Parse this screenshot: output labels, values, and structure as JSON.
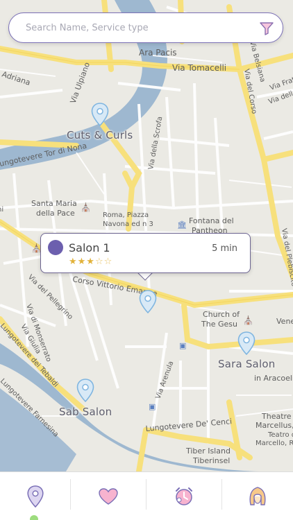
{
  "search": {
    "placeholder": "Search Name, Service type",
    "filter_icon": "filter-icon"
  },
  "map": {
    "street_labels": [
      "Via Tomacelli",
      "Via del Corso",
      "Ara Pacis",
      "Adriana",
      "Via Ulpiano",
      "Lungotevere Tor di Nona",
      "Via della Scrofa",
      "Santa Maria della Pace",
      "Roma, Piazza Navona ed n 3",
      "Fontana del Pantheon",
      "Corso Vittorio Emanuele",
      "Via del Pellegrino",
      "Via di Monserrato",
      "Via Giulia",
      "Church of The Gesu",
      "Lungotevere dei Tebaldi",
      "Lungotevere Farnesina",
      "Via Arenula",
      "Lungotevere De' Cenci",
      "Tiber Island Tiberinsel",
      "Theatre of Marcellus",
      "Via Belsiana",
      "Via Frattina",
      "Via della Vite",
      "Via del Plebiscito",
      "Venezia",
      "in Aracoeli",
      "Teatro di Marcello"
    ]
  },
  "salons": [
    {
      "name": "Cuts & Curls"
    },
    {
      "name": "Sara Salon"
    },
    {
      "name": "Sab Salon"
    }
  ],
  "popup": {
    "name": "Salon 1",
    "time": "5 min",
    "stars_filled": "★★★",
    "stars_empty": "☆☆",
    "rating": 3,
    "max_rating": 5,
    "dot_color": "#6c5fae"
  },
  "tabs": [
    {
      "icon": "location-pin-icon",
      "active": true
    },
    {
      "icon": "heart-icon",
      "active": false
    },
    {
      "icon": "alarm-clock-icon",
      "active": false
    },
    {
      "icon": "hairstyle-icon",
      "active": false
    }
  ],
  "colors": {
    "accent": "#7a6fb6",
    "pin": "#8fc1e6",
    "heart": "#f3a7c8",
    "road": "#f7e07c",
    "river": "#9eb8d0",
    "active_dot": "#9ddc7e"
  }
}
